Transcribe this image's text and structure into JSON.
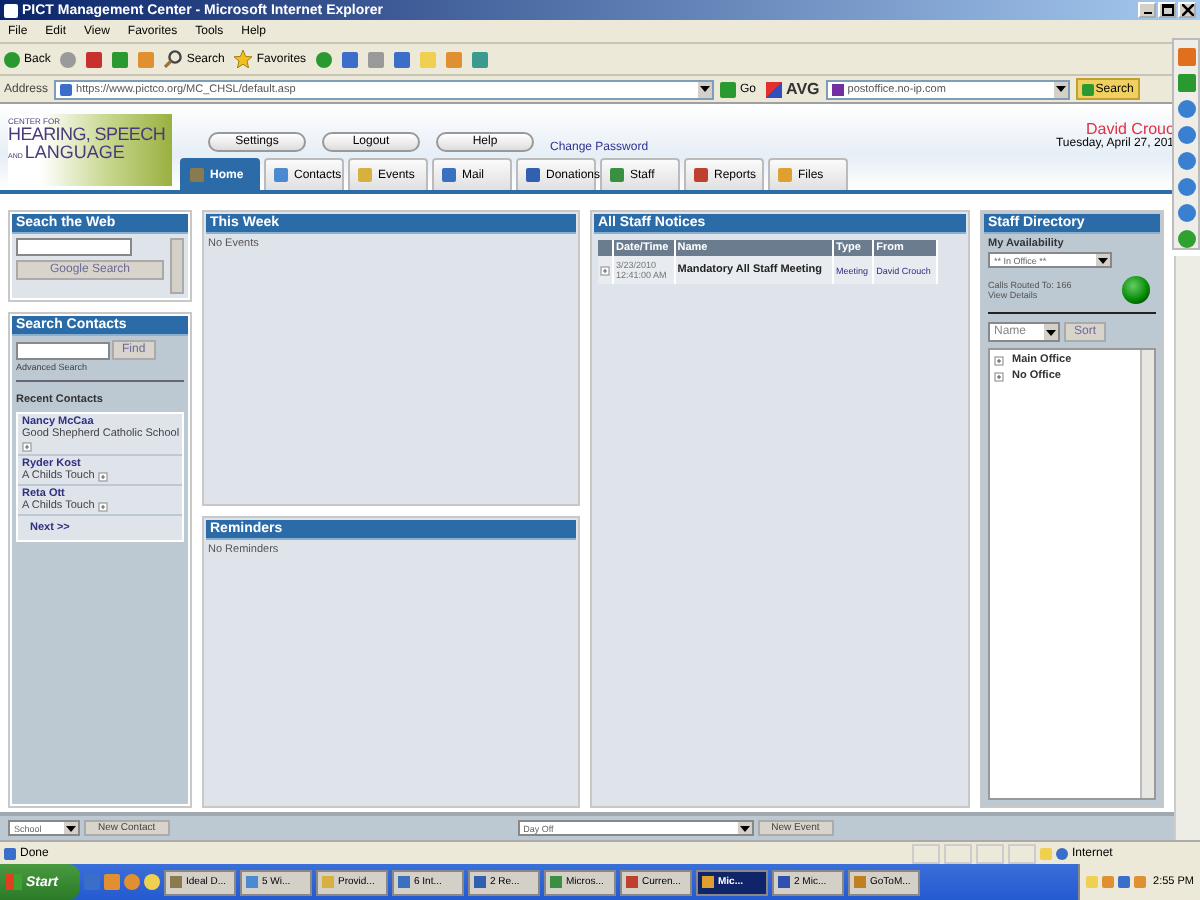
{
  "window": {
    "title": "PICT Management Center - Microsoft Internet Explorer"
  },
  "menu": [
    "File",
    "Edit",
    "View",
    "Favorites",
    "Tools",
    "Help"
  ],
  "toolbar": {
    "back": "Back",
    "search": "Search",
    "favorites": "Favorites"
  },
  "address": {
    "label": "Address",
    "value": "https://www.pictco.org/MC_CHSL/default.asp",
    "go": "Go"
  },
  "avg": {
    "label": "AVG",
    "search_value": "postoffice.no-ip.com",
    "search_button": "Search"
  },
  "header": {
    "logo": {
      "line1": "CENTER FOR",
      "line2": "HEARING, SPEECH",
      "line3_small": "AND",
      "line3": "LANGUAGE"
    },
    "buttons": [
      "Settings",
      "Logout",
      "Help"
    ],
    "change_password": "Change Password",
    "user_name": "David Crouc",
    "date": "Tuesday, April 27, 201"
  },
  "tabs": [
    {
      "label": "Home",
      "selected": true
    },
    {
      "label": "Contacts",
      "selected": false
    },
    {
      "label": "Events",
      "selected": false
    },
    {
      "label": "Mail",
      "selected": false
    },
    {
      "label": "Donations",
      "selected": false
    },
    {
      "label": "Staff",
      "selected": false
    },
    {
      "label": "Reports",
      "selected": false
    },
    {
      "label": "Files",
      "selected": false
    }
  ],
  "search_web": {
    "title": "Seach the Web",
    "button": "Google Search"
  },
  "search_contacts": {
    "title": "Search Contacts",
    "button": "Find",
    "advanced": "Advanced Search",
    "recent_title": "Recent Contacts",
    "next": "Next >>",
    "contacts": [
      {
        "name": "Nancy McCaa",
        "org": "Good Shepherd Catholic School"
      },
      {
        "name": "Ryder Kost",
        "org": "A Childs Touch"
      },
      {
        "name": "Reta Ott",
        "org": "A Childs Touch"
      }
    ]
  },
  "this_week": {
    "title": "This Week",
    "empty": "No Events"
  },
  "reminders": {
    "title": "Reminders",
    "empty": "No Reminders"
  },
  "notices": {
    "title": "All Staff Notices",
    "columns": [
      "Date/Time",
      "Name",
      "Type",
      "From"
    ],
    "rows": [
      {
        "date": "3/23/2010",
        "time": "12:41:00 AM",
        "name": "Mandatory All Staff Meeting",
        "type": "Meeting",
        "from": "David Crouch"
      }
    ]
  },
  "directory": {
    "title": "Staff Directory",
    "availability_label": "My Availability",
    "availability_value": "** In Office **",
    "calls": "Calls Routed To: 166",
    "view_details": "View Details",
    "sort_field": "Name",
    "sort_button": "Sort",
    "offices": [
      {
        "label": "Main Office",
        "expanded": false
      },
      {
        "label": "No Office",
        "expanded": false
      }
    ]
  },
  "bottom_bar": {
    "contact_type": "School",
    "new_contact": "New Contact",
    "event_type": "Day Off",
    "new_event": "New Event"
  },
  "status_bar": {
    "text": "Done",
    "zone": "Internet"
  },
  "taskbar": {
    "start": "Start",
    "clock": "2:55 PM",
    "tasks": [
      {
        "label": "Ideal D...",
        "selected": false
      },
      {
        "label": "5 Wi...",
        "selected": false
      },
      {
        "label": "Provid...",
        "selected": false
      },
      {
        "label": "6 Int...",
        "selected": false
      },
      {
        "label": "2 Re...",
        "selected": false
      },
      {
        "label": "Micros...",
        "selected": false
      },
      {
        "label": "Curren...",
        "selected": false
      },
      {
        "label": "Mic...",
        "selected": true
      },
      {
        "label": "2 Mic...",
        "selected": false
      },
      {
        "label": "GoToM...",
        "selected": false
      }
    ]
  }
}
